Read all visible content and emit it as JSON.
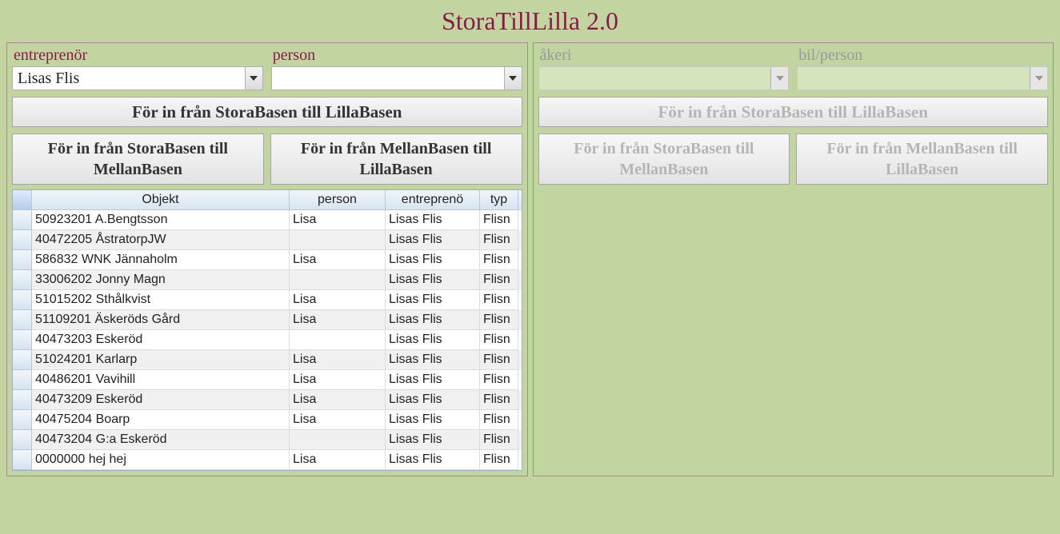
{
  "app_title": "StoraTillLilla 2.0",
  "left": {
    "labels": {
      "contractor": "entreprenör",
      "person": "person"
    },
    "contractor_value": "Lisas Flis",
    "person_value": "",
    "buttons": {
      "big": "För in från StoraBasen till LillaBasen",
      "half1": "För in från StoraBasen till MellanBasen",
      "half2": "För in från MellanBasen till LillaBasen"
    }
  },
  "right": {
    "labels": {
      "carrier": "åkeri",
      "vehicle": "bil/person"
    },
    "carrier_value": "",
    "vehicle_value": "",
    "buttons": {
      "big": "För in från StoraBasen till LillaBasen",
      "half1": "För in från StoraBasen till MellanBasen",
      "half2": "För in från MellanBasen till LillaBasen"
    }
  },
  "grid": {
    "headers": {
      "objekt": "Objekt",
      "person": "person",
      "entreprenor": "entreprenö",
      "typ": "typ"
    },
    "rows": [
      {
        "objekt": "50923201 A.Bengtsson",
        "person": "Lisa",
        "entreprenor": "Lisas Flis",
        "typ": "Flisn"
      },
      {
        "objekt": "40472205 ÅstratorpJW",
        "person": "",
        "entreprenor": "Lisas Flis",
        "typ": "Flisn"
      },
      {
        "objekt": "586832 WNK Jännaholm",
        "person": "Lisa",
        "entreprenor": "Lisas Flis",
        "typ": "Flisn"
      },
      {
        "objekt": "33006202 Jonny Magn",
        "person": "",
        "entreprenor": "Lisas Flis",
        "typ": "Flisn"
      },
      {
        "objekt": "51015202 Sthålkvist",
        "person": "Lisa",
        "entreprenor": "Lisas Flis",
        "typ": "Flisn"
      },
      {
        "objekt": "51109201 Äskeröds Gård",
        "person": "Lisa",
        "entreprenor": "Lisas Flis",
        "typ": "Flisn"
      },
      {
        "objekt": "40473203 Eskeröd",
        "person": "",
        "entreprenor": "Lisas Flis",
        "typ": "Flisn"
      },
      {
        "objekt": "51024201 Karlarp",
        "person": "Lisa",
        "entreprenor": "Lisas Flis",
        "typ": "Flisn"
      },
      {
        "objekt": "40486201 Vavihill",
        "person": "Lisa",
        "entreprenor": "Lisas Flis",
        "typ": "Flisn"
      },
      {
        "objekt": "40473209 Eskeröd",
        "person": "Lisa",
        "entreprenor": "Lisas Flis",
        "typ": "Flisn"
      },
      {
        "objekt": "40475204 Boarp",
        "person": "Lisa",
        "entreprenor": "Lisas Flis",
        "typ": "Flisn"
      },
      {
        "objekt": "40473204 G:a Eskeröd",
        "person": "",
        "entreprenor": "Lisas Flis",
        "typ": "Flisn"
      },
      {
        "objekt": "0000000 hej hej",
        "person": "Lisa",
        "entreprenor": "Lisas Flis",
        "typ": "Flisn"
      }
    ]
  }
}
